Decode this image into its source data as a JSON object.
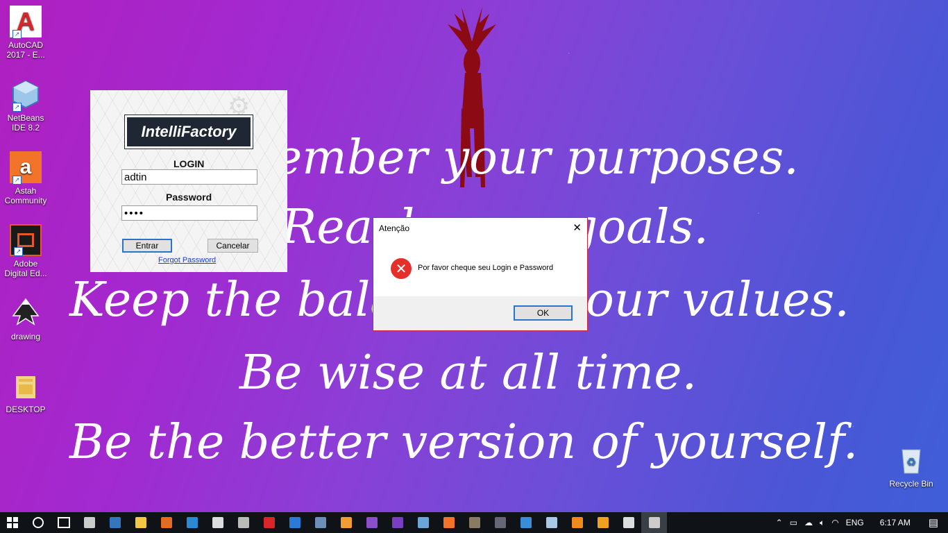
{
  "wallpaper": {
    "lines": [
      "ember your purposes.",
      "Reach your goals.",
      "Keep the balance of your values.",
      "Be wise at all time.",
      "Be the better version of yourself."
    ],
    "deer_color": "#8b0a14"
  },
  "desktop_icons": [
    {
      "label": "AutoCAD 2017 - E...",
      "icon": "autocad-icon",
      "color": "#d9262b"
    },
    {
      "label": "NetBeans IDE 8.2",
      "icon": "netbeans-icon",
      "color": "#6aa6d8"
    },
    {
      "label": "Astah Community",
      "icon": "astah-icon",
      "color": "#f2742a"
    },
    {
      "label": "Adobe Digital Ed...",
      "icon": "adobe-digital-editions-icon",
      "color": "#1a1a1a"
    },
    {
      "label": "drawing",
      "icon": "inkscape-icon",
      "color": "#222222"
    },
    {
      "label": "DESKTOP",
      "icon": "folder-icon",
      "color": "#e9b94a"
    }
  ],
  "recycle_bin": {
    "label": "Recycle Bin"
  },
  "login_window": {
    "logo": "IntelliFactory",
    "login_label": "LOGIN",
    "login_value": "adtin",
    "password_label": "Password",
    "password_value": "••••",
    "enter_button": "Entrar",
    "cancel_button": "Cancelar",
    "forgot_link": "Forgot Password"
  },
  "dialog": {
    "title": "Atenção",
    "close": "✕",
    "message": "Por favor cheque seu Login e Password",
    "ok_button": "OK"
  },
  "taskbar": {
    "apps": [
      {
        "name": "taskbar-store-icon",
        "color": "#cccccc"
      },
      {
        "name": "taskbar-edge-icon",
        "color": "#3277bc"
      },
      {
        "name": "taskbar-file-explorer-icon",
        "color": "#f3c745"
      },
      {
        "name": "taskbar-firefox-icon",
        "color": "#e66b22"
      },
      {
        "name": "taskbar-internet-explorer-icon",
        "color": "#2a8ad4"
      },
      {
        "name": "taskbar-inkscape-icon",
        "color": "#dddddd"
      },
      {
        "name": "taskbar-app-icon",
        "color": "#bbbbbb"
      },
      {
        "name": "taskbar-autocad-icon",
        "color": "#d9262b"
      },
      {
        "name": "taskbar-visual-studio-code-icon",
        "color": "#2b7bd6"
      },
      {
        "name": "taskbar-app2-icon",
        "color": "#6b8fb8"
      },
      {
        "name": "taskbar-app3-icon",
        "color": "#f39c34"
      },
      {
        "name": "taskbar-visual-studio-purple-icon",
        "color": "#8a4fc9"
      },
      {
        "name": "taskbar-visual-studio-icon",
        "color": "#7a3fc0"
      },
      {
        "name": "taskbar-netbeans-icon",
        "color": "#6aa6d8"
      },
      {
        "name": "taskbar-astah-icon",
        "color": "#f2742a"
      },
      {
        "name": "taskbar-gimp-icon",
        "color": "#8a7c62"
      },
      {
        "name": "taskbar-obs-icon",
        "color": "#666677"
      },
      {
        "name": "taskbar-app4-icon",
        "color": "#3a8ed8"
      },
      {
        "name": "taskbar-notepad-icon",
        "color": "#a8c8e8"
      },
      {
        "name": "taskbar-vlc-icon",
        "color": "#f08a1c"
      },
      {
        "name": "taskbar-media-icon",
        "color": "#f0a020"
      },
      {
        "name": "taskbar-document-icon",
        "color": "#dddddd"
      },
      {
        "name": "taskbar-java-app-icon",
        "color": "#cccccc"
      }
    ],
    "language": "ENG",
    "time": "6:17 AM"
  }
}
